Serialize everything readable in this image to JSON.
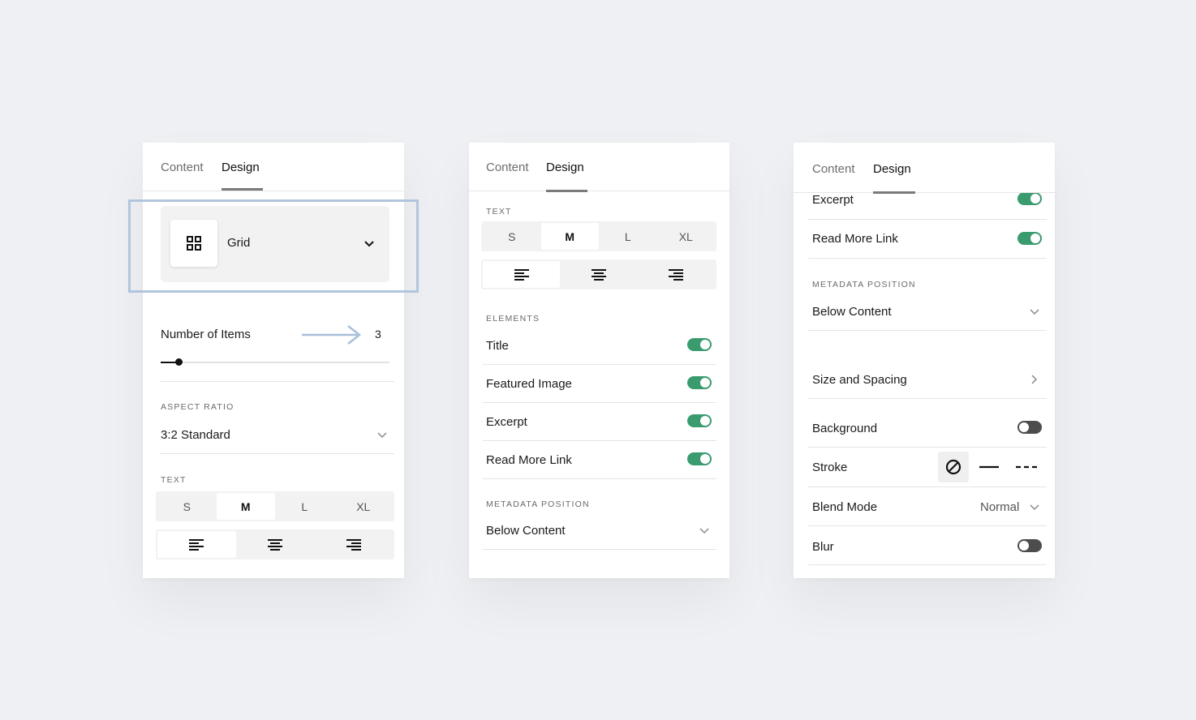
{
  "panel1": {
    "tabs": {
      "content": "Content",
      "design": "Design"
    },
    "layout_select": {
      "value": "Grid",
      "icon": "grid-icon"
    },
    "number_of_items": {
      "label": "Number of Items",
      "value": "3"
    },
    "aspect_ratio": {
      "section": "ASPECT RATIO",
      "value": "3:2 Standard"
    },
    "text": {
      "section": "TEXT",
      "sizes": [
        "S",
        "M",
        "L",
        "XL"
      ],
      "selected": "M"
    }
  },
  "panel2": {
    "tabs": {
      "content": "Content",
      "design": "Design"
    },
    "text": {
      "section": "TEXT",
      "sizes": [
        "S",
        "M",
        "L",
        "XL"
      ],
      "selected": "M"
    },
    "elements": {
      "section": "ELEMENTS",
      "items": [
        {
          "label": "Title",
          "on": true
        },
        {
          "label": "Featured Image",
          "on": true
        },
        {
          "label": "Excerpt",
          "on": true
        },
        {
          "label": "Read More Link",
          "on": true
        }
      ]
    },
    "metadata": {
      "section": "METADATA POSITION",
      "value": "Below Content"
    }
  },
  "panel3": {
    "tabs": {
      "content": "Content",
      "design": "Design"
    },
    "excerpt": {
      "label": "Excerpt",
      "on": true
    },
    "read_more": {
      "label": "Read More Link",
      "on": true
    },
    "metadata": {
      "section": "METADATA POSITION",
      "value": "Below Content"
    },
    "size_spacing": {
      "label": "Size and Spacing"
    },
    "background": {
      "label": "Background",
      "on": false
    },
    "stroke": {
      "label": "Stroke"
    },
    "blend_mode": {
      "label": "Blend Mode",
      "value": "Normal"
    },
    "blur": {
      "label": "Blur",
      "on": false
    }
  },
  "colors": {
    "toggle_on": "#3a9b6f",
    "toggle_off": "#4d4d4d",
    "highlight": "#b1c6dd"
  }
}
